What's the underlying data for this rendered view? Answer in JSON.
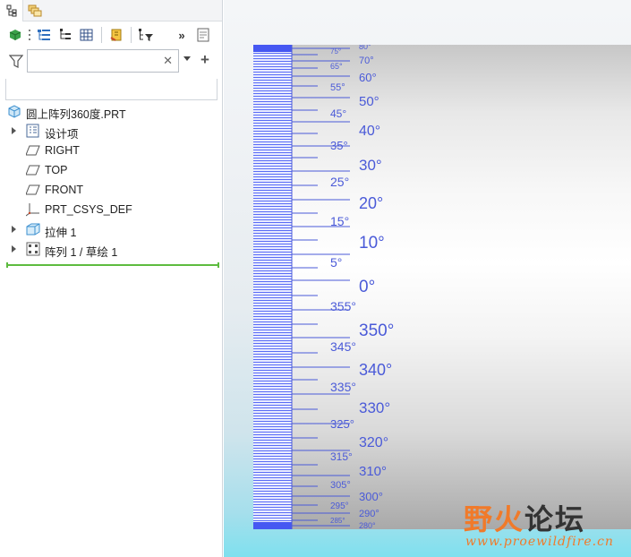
{
  "panel": {
    "tabs": [
      {
        "icon": "model-tree-icon",
        "active": true
      },
      {
        "icon": "layers-icon",
        "active": false
      }
    ],
    "toolbar_icons": [
      "part-icon",
      "tree-columns-icon",
      "tree-settings-icon",
      "table-icon",
      "show-icon",
      "filter-tree-icon",
      "more-icon",
      "notes-icon"
    ],
    "search": {
      "value": "",
      "placeholder": ""
    },
    "tree": [
      {
        "label": "圆上阵列360度.PRT",
        "icon": "part-icon",
        "expandable": false,
        "level": 0
      },
      {
        "label": "设计项",
        "icon": "design-items-icon",
        "expandable": true,
        "level": 1
      },
      {
        "label": "RIGHT",
        "icon": "datum-plane-icon",
        "expandable": false,
        "level": 1
      },
      {
        "label": "TOP",
        "icon": "datum-plane-icon",
        "expandable": false,
        "level": 1
      },
      {
        "label": "FRONT",
        "icon": "datum-plane-icon",
        "expandable": false,
        "level": 1
      },
      {
        "label": "PRT_CSYS_DEF",
        "icon": "csys-icon",
        "expandable": false,
        "level": 1
      },
      {
        "label": "拉伸 1",
        "icon": "extrude-icon",
        "expandable": true,
        "level": 1
      },
      {
        "label": "阵列 1 / 草绘 1",
        "icon": "pattern-icon",
        "expandable": true,
        "level": 1
      }
    ]
  },
  "viewport": {
    "ruler_labels_left": [
      "75°",
      "65°",
      "55°",
      "45°",
      "35°",
      "25°",
      "15°",
      "5°",
      "355°",
      "345°",
      "335°",
      "325°",
      "315°",
      "305°",
      "295°",
      "285°"
    ],
    "ruler_labels_right": [
      "80°",
      "70°",
      "60°",
      "50°",
      "40°",
      "30°",
      "20°",
      "10°",
      "0°",
      "350°",
      "340°",
      "330°",
      "320°",
      "310°",
      "300°",
      "290°",
      "280°"
    ],
    "watermark_cn_accent": "野火",
    "watermark_cn_rest": "论坛",
    "watermark_url": "www.proewildfire.cn",
    "colors": {
      "scale": "#5a6cf6",
      "label": "#4a5ad8",
      "watermark": "#f07a2a"
    }
  }
}
